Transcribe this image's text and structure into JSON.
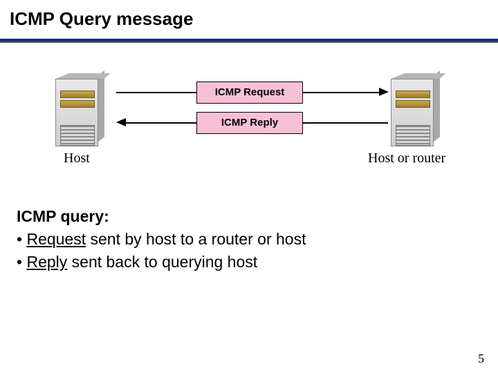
{
  "title": "ICMP Query message",
  "diagram": {
    "request_label": "ICMP Request",
    "reply_label": "ICMP Reply",
    "left_host_label": "Host",
    "right_host_label": "Host or router"
  },
  "body": {
    "heading": "ICMP query:",
    "bullet1_pre": "•   ",
    "bullet1_u": "Request",
    "bullet1_post": " sent by host to a router or host",
    "bullet2_pre": "•   ",
    "bullet2_u": "Reply",
    "bullet2_post": " sent back to querying host"
  },
  "page_number": "5"
}
